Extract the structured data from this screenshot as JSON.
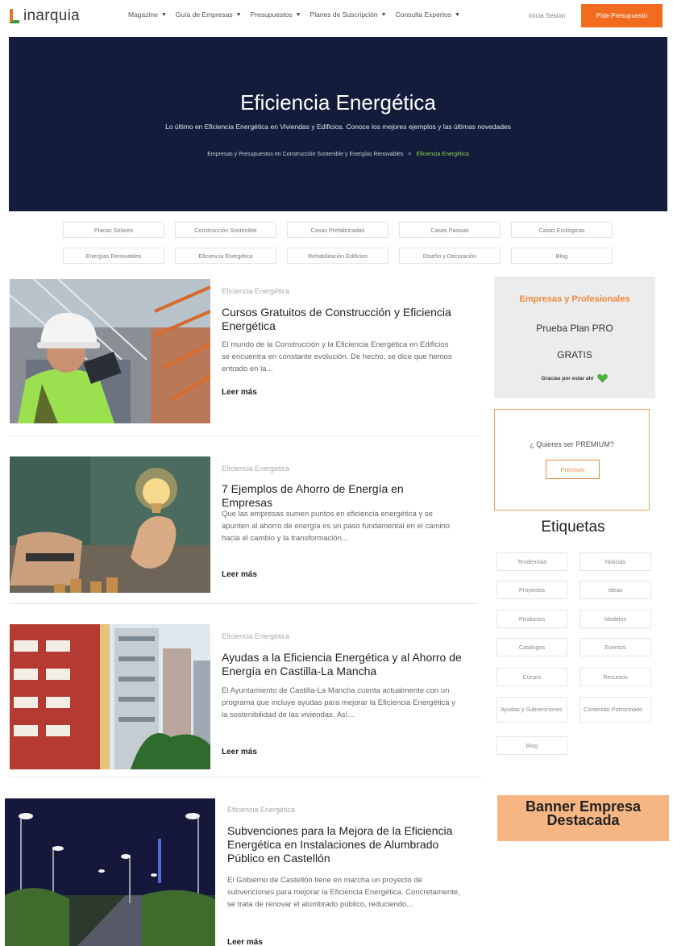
{
  "header": {
    "logo_text": "inarquia",
    "nav": [
      {
        "label": "Magazine"
      },
      {
        "label": "Guía de Empresas"
      },
      {
        "label": "Presupuestos"
      },
      {
        "label": "Planes de Suscripción"
      },
      {
        "label": "Consulta Expertos"
      }
    ],
    "login_label": "Inicia Sesion",
    "cta_label": "Pide Presupuesto"
  },
  "hero": {
    "title": "Eficiencia Energética",
    "subtitle": "Lo último en Eficiencia Energética en Viviendas y Edificios. Conoce los mejores ejemplos y las últimas novedades",
    "breadcrumb_parent": "Empresas y Presupuestos en Construcción Sostenible y Energías Renovables",
    "breadcrumb_sep": ">",
    "breadcrumb_current": "Eficiencia Energética"
  },
  "categories": [
    "Placas Solares",
    "Construcción Sostenible",
    "Casas Prefabricadas",
    "Casas Pasivas",
    "Casas Ecológicas",
    "Energías Renovables",
    "Eficiencia Energética",
    "Rehabilitación Edificios",
    "Diseño y Decoración",
    "Blog"
  ],
  "articles": [
    {
      "category": "Eficiencia Energética",
      "title": "Cursos Gratuitos de Construcción y Eficiencia Energética",
      "excerpt": "El mundo de la Construcción y la Eficiencia Energética en Edificios se encuentra en constante evolución. De hecho, se dice que hemos entrado en la...",
      "more": "Leer más"
    },
    {
      "category": "Eficiencia Energética",
      "title": "7 Ejemplos de Ahorro de Energía en Empresas",
      "excerpt": "Que las empresas sumen puntos en eficiencia energética y se apunten al ahorro de energía es un paso fundamental en el camino hacia el cambio y la transformación...",
      "more": "Leer más"
    },
    {
      "category": "Eficiencia Energética",
      "title": "Ayudas a la Eficiencia Energética y al Ahorro de Energía en Castilla-La Mancha",
      "excerpt": "El Ayuntamiento de Castilla-La Mancha cuenta actualmente con un programa que incluye ayudas para mejorar la Eficiencia Energética y la sostenibilidad de las viviendas. Así...",
      "more": "Leer más"
    },
    {
      "category": "Eficiencia Energética",
      "title": "Subvenciones para la Mejora de la Eficiencia Energética en Instalaciones de Alumbrado Público en Castellón",
      "excerpt": "El Gobierno de Castellón tiene en marcha un proyecto de subvenciones para mejorar la Eficiencia Energética. Concretamente, se trata de renovar el alumbrado público, reduciendo...",
      "more": "Leer más"
    }
  ],
  "sidebar": {
    "promo_title": "Empresas y Profesionales",
    "promo_line1": "Prueba Plan PRO",
    "promo_line2": "GRATIS",
    "promo_thanks": "Gracias por estar ahí",
    "premium_question": "¿ Quieres ser PREMIUM?",
    "premium_button": "Premium",
    "tags_title": "Etiquetas",
    "tags": [
      "Tendencias",
      "Noticias",
      "Proyectos",
      "Ideas",
      "Productos",
      "Modelos",
      "Catalogos",
      "Eventos",
      "Cursos",
      "Recursos",
      "Ayudas y Subvenciones",
      "Contenido Patrocinado",
      "Blog"
    ],
    "banner_line1": "Banner Empresa",
    "banner_line2": "Destacada"
  },
  "colors": {
    "accent": "#f26c1f",
    "hero_bg": "#131d3b",
    "breadcrumb_current": "#8bd14a",
    "banner_bg": "#f5b684"
  }
}
